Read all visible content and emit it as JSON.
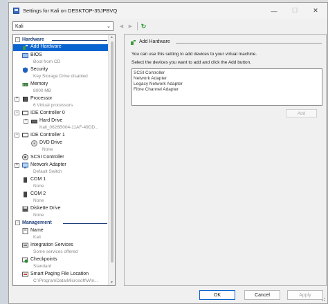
{
  "window": {
    "title": "Settings for Kali on DESKTOP-35JPBVQ",
    "controls": {
      "minimize": "—",
      "maximize": "☐",
      "close": "✕"
    }
  },
  "toolbar": {
    "vm_selected": "Kali",
    "back": "◀",
    "forward": "▶",
    "refresh": "↻"
  },
  "tree": {
    "hardware_header": "Hardware",
    "management_header": "Management",
    "hardware": [
      {
        "name": "Add Hardware",
        "sub": ""
      },
      {
        "name": "BIOS",
        "sub": "Boot from CD"
      },
      {
        "name": "Security",
        "sub": "Key Storage Drive disabled"
      },
      {
        "name": "Memory",
        "sub": "8000 MB"
      },
      {
        "name": "Processor",
        "sub": "6 Virtual processors"
      },
      {
        "name": "IDE Controller 0",
        "sub": ""
      },
      {
        "name": "Hard Drive",
        "sub": "Kali_0626B004-11AF-49DD..."
      },
      {
        "name": "IDE Controller 1",
        "sub": ""
      },
      {
        "name": "DVD Drive",
        "sub": "None"
      },
      {
        "name": "SCSI Controller",
        "sub": ""
      },
      {
        "name": "Network Adapter",
        "sub": "Default Switch"
      },
      {
        "name": "COM 1",
        "sub": "None"
      },
      {
        "name": "COM 2",
        "sub": "None"
      },
      {
        "name": "Diskette Drive",
        "sub": "None"
      }
    ],
    "management": [
      {
        "name": "Name",
        "sub": "Kali"
      },
      {
        "name": "Integration Services",
        "sub": "Some services offered"
      },
      {
        "name": "Checkpoints",
        "sub": "Standard"
      },
      {
        "name": "Smart Paging File Location",
        "sub": "C:\\ProgramData\\Microsoft\\Win..."
      }
    ]
  },
  "panel": {
    "title": "Add Hardware",
    "line1": "You can use this setting to add devices to your virtual machine.",
    "line2": "Select the devices you want to add and click the Add button.",
    "devices": [
      "SCSI Controller",
      "Network Adapter",
      "Legacy Network Adapter",
      "Fibre Channel Adapter"
    ],
    "add_label": "Add"
  },
  "footer": {
    "ok": "OK",
    "cancel": "Cancel",
    "apply": "Apply"
  },
  "colors": {
    "selection": "#0a64d0",
    "section_header": "#1f3f7a"
  }
}
